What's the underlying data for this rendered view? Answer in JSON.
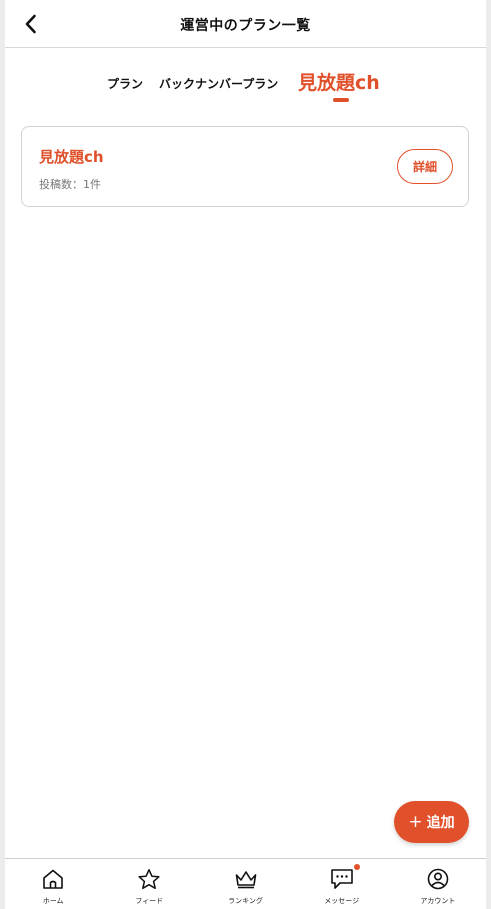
{
  "header": {
    "title": "運営中のプラン一覧",
    "back_icon": "chevron-left-icon"
  },
  "tabs": [
    {
      "label": "プラン",
      "active": false
    },
    {
      "label": "バックナンバープラン",
      "active": false
    },
    {
      "label": "見放題ch",
      "active": true
    }
  ],
  "plan_card": {
    "name": "見放題ch",
    "posts": "投稿数：1件",
    "detail_label": "詳細"
  },
  "fab": {
    "label": "追加",
    "icon": "plus-icon"
  },
  "bottom_nav": [
    {
      "label": "ホーム",
      "icon": "home-icon"
    },
    {
      "label": "フィード",
      "icon": "star-icon"
    },
    {
      "label": "ランキング",
      "icon": "crown-icon"
    },
    {
      "label": "メッセージ",
      "icon": "chat-icon",
      "notification": true
    },
    {
      "label": "アカウント",
      "icon": "account-icon"
    }
  ],
  "colors": {
    "accent": "#e0512b",
    "border": "#d3d3d3",
    "text": "#111111",
    "muted": "#777777"
  }
}
